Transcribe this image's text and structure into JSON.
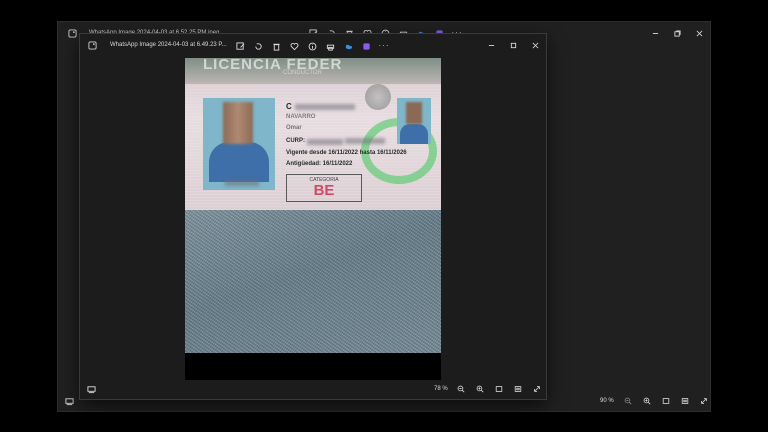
{
  "back_window": {
    "title": "WhatsApp Image 2024-04-03 at 6.52.25 PM.jpeg",
    "zoom": "90 %"
  },
  "front_window": {
    "title": "WhatsApp Image 2024-04-03 at 6.49.23 P...",
    "zoom": "78 %"
  },
  "card": {
    "banner": "LICENCIA FEDER",
    "sub": "CONDUCTOR",
    "name_prefix": "C",
    "surname": "NAVARRO",
    "third_line": "Omar",
    "curp_label": "CURP:",
    "validity": "Vigente desde 16/11/2022 hasta 16/11/2026",
    "seniority": "Antigüedad: 16/11/2022",
    "category_label": "CATEGORIA",
    "category_value": "BE"
  },
  "icons": {
    "toolbar": [
      "edit-icon",
      "rotate-icon",
      "delete-icon",
      "favorite-icon",
      "info-icon",
      "print-icon",
      "onedrive-icon",
      "clipchamp-icon",
      "more-icon"
    ],
    "status": [
      "zoom-out-icon",
      "zoom-in-icon",
      "actual-size-icon",
      "fit-icon",
      "fullscreen-icon"
    ]
  },
  "colors": {
    "accent_edit_blue": "#3c8de0",
    "clipchamp_purple": "#8a5cf0",
    "category_red": "#d24a6a"
  }
}
